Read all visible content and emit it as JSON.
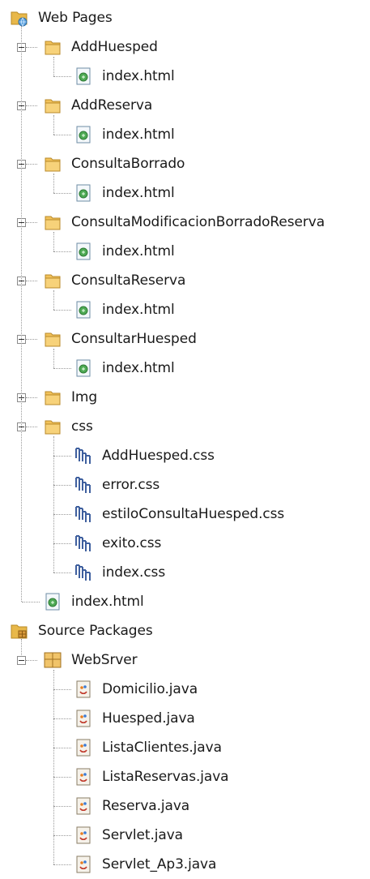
{
  "tree": [
    {
      "label": "Web Pages",
      "icon": "web-pages-folder-icon",
      "level": 0
    },
    {
      "label": "AddHuesped",
      "icon": "folder-icon",
      "level": 1,
      "expander": "expanded"
    },
    {
      "label": "index.html",
      "icon": "html-file-icon",
      "level": 2
    },
    {
      "label": "AddReserva",
      "icon": "folder-icon",
      "level": 1,
      "expander": "expanded"
    },
    {
      "label": "index.html",
      "icon": "html-file-icon",
      "level": 2
    },
    {
      "label": "ConsultaBorrado",
      "icon": "folder-icon",
      "level": 1,
      "expander": "expanded"
    },
    {
      "label": "index.html",
      "icon": "html-file-icon",
      "level": 2
    },
    {
      "label": "ConsultaModificacionBorradoReserva",
      "icon": "folder-icon",
      "level": 1,
      "expander": "expanded"
    },
    {
      "label": "index.html",
      "icon": "html-file-icon",
      "level": 2
    },
    {
      "label": "ConsultaReserva",
      "icon": "folder-icon",
      "level": 1,
      "expander": "expanded"
    },
    {
      "label": "index.html",
      "icon": "html-file-icon",
      "level": 2
    },
    {
      "label": "ConsultarHuesped",
      "icon": "folder-icon",
      "level": 1,
      "expander": "expanded"
    },
    {
      "label": "index.html",
      "icon": "html-file-icon",
      "level": 2
    },
    {
      "label": "Img",
      "icon": "folder-icon",
      "level": 1,
      "expander": "collapsed"
    },
    {
      "label": "css",
      "icon": "folder-icon",
      "level": 1,
      "expander": "expanded"
    },
    {
      "label": "AddHuesped.css",
      "icon": "css-file-icon",
      "level": 2
    },
    {
      "label": "error.css",
      "icon": "css-file-icon",
      "level": 2
    },
    {
      "label": "estiloConsultaHuesped.css",
      "icon": "css-file-icon",
      "level": 2
    },
    {
      "label": "exito.css",
      "icon": "css-file-icon",
      "level": 2
    },
    {
      "label": "index.css",
      "icon": "css-file-icon",
      "level": 2
    },
    {
      "label": "index.html",
      "icon": "html-file-icon",
      "level": 1
    },
    {
      "label": "Source Packages",
      "icon": "source-packages-icon",
      "level": 0
    },
    {
      "label": "WebSrver",
      "icon": "package-icon",
      "level": 1,
      "expander": "expanded"
    },
    {
      "label": "Domicilio.java",
      "icon": "java-file-icon",
      "level": 2
    },
    {
      "label": "Huesped.java",
      "icon": "java-file-icon",
      "level": 2
    },
    {
      "label": "ListaClientes.java",
      "icon": "java-file-icon",
      "level": 2
    },
    {
      "label": "ListaReservas.java",
      "icon": "java-file-icon",
      "level": 2
    },
    {
      "label": "Reserva.java",
      "icon": "java-file-icon",
      "level": 2
    },
    {
      "label": "Servlet.java",
      "icon": "java-file-icon",
      "level": 2
    },
    {
      "label": "Servlet_Ap3.java",
      "icon": "java-file-icon",
      "level": 2
    }
  ]
}
